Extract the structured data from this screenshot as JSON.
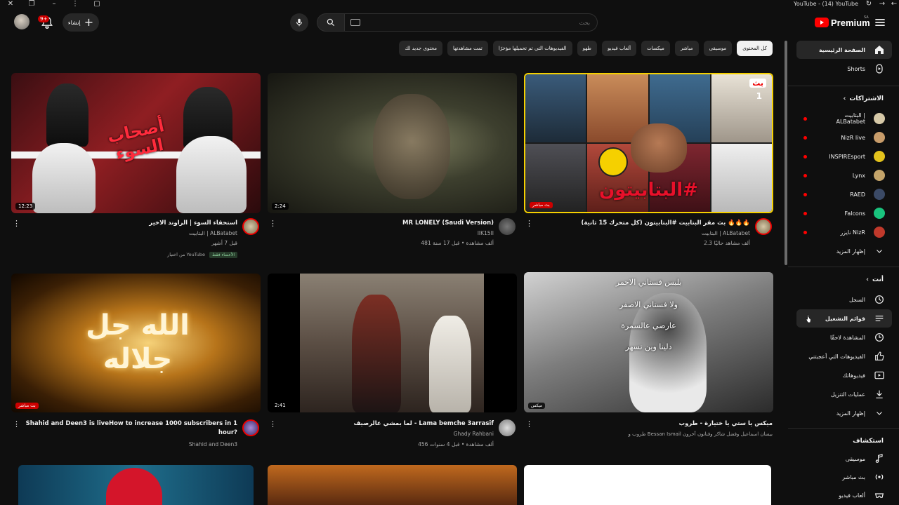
{
  "window": {
    "title": "YouTube - (14) YouTube"
  },
  "header": {
    "logo_text": "Premium",
    "logo_region": "SA",
    "search_placeholder": "بحث",
    "create_label": "إنشاء",
    "notifications_count": "9+"
  },
  "chips": [
    {
      "label": "كل المحتوى",
      "active": true
    },
    {
      "label": "موسيقى"
    },
    {
      "label": "مباشر"
    },
    {
      "label": "ميكسات"
    },
    {
      "label": "ألعاب فيديو"
    },
    {
      "label": "طهو"
    },
    {
      "label": "الفيديوهات التي تم تحميلها مؤخرًا"
    },
    {
      "label": "تمت مشاهدتها"
    },
    {
      "label": "محتوى جديد لك"
    }
  ],
  "videos": {
    "v1": {
      "title": "بث مقر البتابيت #البتابيتون (كل متحرك 15 ثانية) 🔥🔥🔥",
      "channel": "البتابيت | ALBatabet",
      "meta": "2.3 ألف مشاهد حاليًا",
      "badge": "بث مباشر",
      "thumb_text": "#البتابيتون",
      "thumb_tag": "بث",
      "thumb_num": "1"
    },
    "v2": {
      "title": "MR LONELY (Saudi Version)",
      "channel": "IIK15II",
      "meta": "481 ألف مشاهدة • قبل 17 سنة",
      "duration": "2:24"
    },
    "v3": {
      "title": "استحقاء السوء | الراوند الاخير",
      "channel": "البتابيت | ALBatabet",
      "meta": "قبل 7 أشهر",
      "duration": "12:23",
      "members": "الأعضاء فقط",
      "pick": "من اختيار YouTube",
      "thumb_text": "أصحاب السوء"
    },
    "v4": {
      "title": "ميكس يا ستي يا ختيارة - طروب",
      "channel": "طروب و Bessan Ismail بيسان اسماعيل وفضل شاكر وفنانون آخرون",
      "badge": "ميكس",
      "lyrics": [
        "بلبس فستاني الاحمر",
        "ولا فستاني الاصفر",
        "عارضي عالسمرة",
        "دلينا وين تسهر"
      ]
    },
    "v5": {
      "title": "لما بمشي عالرصيف - Lama bemche 3arrasif",
      "channel": "Ghady Rahbani",
      "meta": "456 ألف مشاهدة • قبل 4 سنوات",
      "duration": "2:41"
    },
    "v6": {
      "title": "Shahid and Deen3 is liveHow to increase 1000 subscribers in 1 hour?",
      "channel": "Shahid and Deen3",
      "badge": "بث مباشر",
      "thumb_text": "الله جل جلاله"
    }
  },
  "sidebar": {
    "main": [
      {
        "label": "الصفحة الرئيسية",
        "icon": "home-icon",
        "active": true
      },
      {
        "label": "Shorts",
        "icon": "shorts-icon"
      }
    ],
    "subs_header": "الاشتراكات",
    "subs": [
      {
        "label": "البتابيت | ALBatabet",
        "color": "#d6c9a8",
        "live": true
      },
      {
        "label": "NizR live",
        "color": "#c89c6a",
        "live": true
      },
      {
        "label": "INSPIREsport",
        "color": "#e3c21c",
        "live": true
      },
      {
        "label": "Lynx",
        "color": "#c4a46a",
        "live": true
      },
      {
        "label": "RAED",
        "color": "#3b4a66",
        "live": true
      },
      {
        "label": "Falcons",
        "color": "#19c37d",
        "live": true
      },
      {
        "label": "نايزر NizR",
        "color": "#c0392b",
        "live": true
      },
      {
        "label": "إظهار المزيد",
        "icon": "chevron-down-icon"
      }
    ],
    "you_header": "أنت",
    "you": [
      {
        "label": "السجل",
        "icon": "history-icon"
      },
      {
        "label": "قوائم التشغيل",
        "icon": "playlist-icon"
      },
      {
        "label": "المشاهدة لاحقًا",
        "icon": "clock-icon"
      },
      {
        "label": "الفيديوهات التي أعجبتني",
        "icon": "like-icon"
      },
      {
        "label": "فيديوهاتك",
        "icon": "your-videos-icon"
      },
      {
        "label": "عمليات التنزيل",
        "icon": "download-icon"
      },
      {
        "label": "إظهار المزيد",
        "icon": "chevron-down-icon"
      }
    ],
    "explore_header": "استكشاف",
    "explore": [
      {
        "label": "موسيقى",
        "icon": "music-icon"
      },
      {
        "label": "بث مباشر",
        "icon": "live-icon"
      },
      {
        "label": "ألعاب فيديو",
        "icon": "gaming-icon"
      }
    ]
  }
}
